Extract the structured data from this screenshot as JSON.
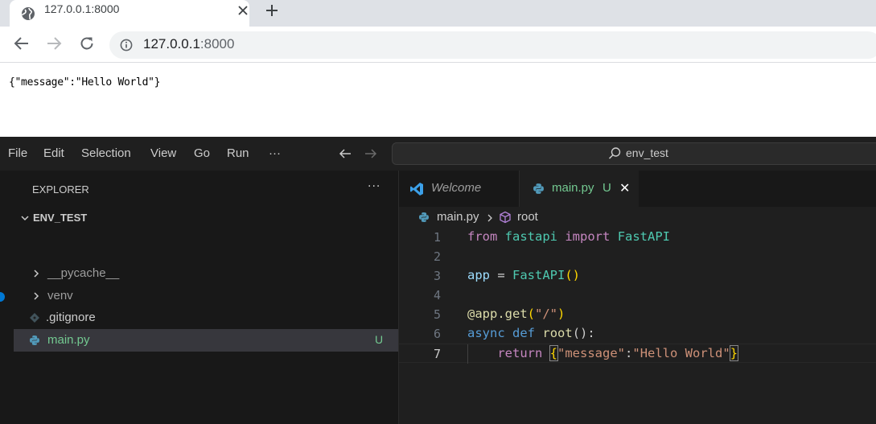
{
  "browser": {
    "tab_title": "127.0.0.1:8000",
    "url_host": "127.0.0.1",
    "url_port": ":8000",
    "body_text": "{\"message\":\"Hello World\"}"
  },
  "vscode": {
    "menu": [
      "File",
      "Edit",
      "Selection",
      "View",
      "Go",
      "Run",
      "···"
    ],
    "command_center": "env_test",
    "explorer": {
      "title": "EXPLORER",
      "more": "···",
      "folder": "ENV_TEST",
      "items": [
        {
          "label": "__pycache__",
          "type": "folder"
        },
        {
          "label": "venv",
          "type": "folder"
        },
        {
          "label": ".gitignore",
          "type": "file"
        },
        {
          "label": "main.py",
          "type": "file",
          "badge": "U"
        }
      ]
    },
    "tabs": [
      {
        "label": "Welcome"
      },
      {
        "label": "main.py",
        "badge": "U",
        "close": "✕"
      }
    ],
    "breadcrumb": {
      "file": "main.py",
      "symbol": "root"
    },
    "code": {
      "line_numbers": [
        "1",
        "2",
        "3",
        "4",
        "5",
        "6",
        "7"
      ],
      "l1": {
        "a": "from",
        "b": "fastapi",
        "c": "import",
        "d": "FastAPI"
      },
      "l3": {
        "a": "app",
        "b": " = ",
        "c": "FastAPI",
        "d": "()"
      },
      "l5": {
        "a": "@app",
        "b": ".",
        "c": "get",
        "d": "(",
        "e": "\"/\"",
        "f": ")"
      },
      "l6": {
        "a": "async",
        "b": "def",
        "c": "root",
        "d": "():"
      },
      "l7": {
        "a": "return",
        "b": "{",
        "c": "\"message\"",
        "d": ":",
        "e": "\"Hello World\"",
        "f": "}"
      }
    },
    "colors": {
      "accent": "#0078d4",
      "untracked": "#73c991",
      "python_icon": "#519aba"
    }
  }
}
